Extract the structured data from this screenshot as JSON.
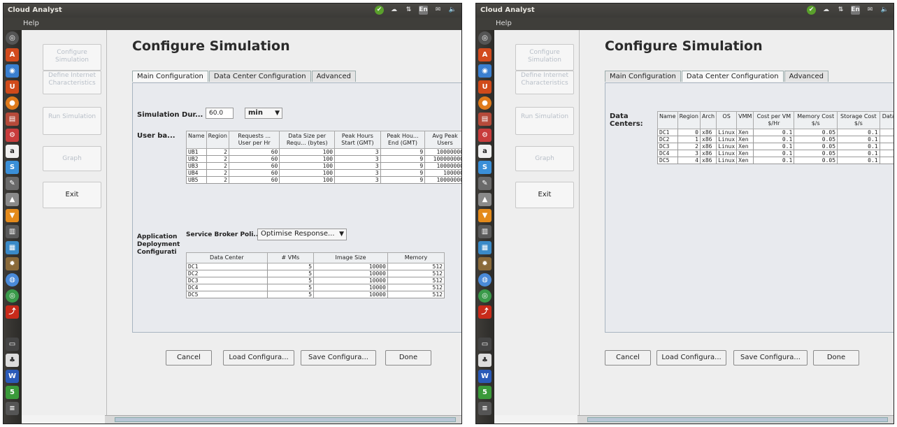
{
  "colors": {
    "accent": "#3a5ea8",
    "titlebar": "#3b3a37",
    "launcher": "#2c2b28",
    "nav_disabled_text": "#b8bfc8"
  },
  "left": {
    "window_title": "Cloud Analyst",
    "menu": "Help",
    "nav": {
      "configure": "Configure Simulation",
      "define": "Define Internet Characteristics",
      "run": "Run Simulation",
      "graph": "Graph",
      "exit": "Exit"
    },
    "page_title": "Configure Simulation",
    "tabs": [
      "Main Configuration",
      "Data Center Configuration",
      "Advanced"
    ],
    "sim_duration_label": "Simulation Dur...",
    "sim_duration_value": "60.0",
    "sim_duration_unit": "min",
    "userbase_label": "User ba...",
    "userbase_headers": [
      "Name",
      "Region",
      "Requests ... User per Hr",
      "Data Size per Requ... (bytes)",
      "Peak Hours Start (GMT)",
      "Peak Hou... End (GMT)",
      "Avg Peak Users"
    ],
    "userbase_rows": [
      [
        "UB1",
        "2",
        "60",
        "100",
        "3",
        "9",
        "10000000"
      ],
      [
        "UB2",
        "2",
        "60",
        "100",
        "3",
        "9",
        "100000000"
      ],
      [
        "UB3",
        "2",
        "60",
        "100",
        "3",
        "9",
        "10000000"
      ],
      [
        "UB4",
        "2",
        "60",
        "100",
        "3",
        "9",
        "100000"
      ],
      [
        "UB5",
        "2",
        "60",
        "100",
        "3",
        "9",
        "10000000"
      ]
    ],
    "appdeploy_label": "Application Deployment Configurati",
    "broker_label": "Service Broker Poli...",
    "broker_value": "Optimise Response...",
    "deploy_headers": [
      "Data Center",
      "# VMs",
      "Image Size",
      "Memory"
    ],
    "deploy_rows": [
      [
        "DC1",
        "5",
        "10000",
        "512"
      ],
      [
        "DC2",
        "5",
        "10000",
        "512"
      ],
      [
        "DC3",
        "5",
        "10000",
        "512"
      ],
      [
        "DC4",
        "5",
        "10000",
        "512"
      ],
      [
        "DC5",
        "5",
        "10000",
        "512"
      ]
    ],
    "buttons": {
      "cancel": "Cancel",
      "load": "Load Configura...",
      "save": "Save Configura...",
      "done": "Done"
    }
  },
  "right": {
    "window_title": "Cloud Analyst",
    "menu": "Help",
    "nav": {
      "configure": "Configure Simulation",
      "define": "Define Internet Characteristics",
      "run": "Run Simulation",
      "graph": "Graph",
      "exit": "Exit"
    },
    "page_title": "Configure Simulation",
    "tabs": [
      "Main Configuration",
      "Data Center Configuration",
      "Advanced"
    ],
    "dc_label": "Data Centers:",
    "dc_headers": [
      "Name",
      "Region",
      "Arch",
      "OS",
      "VMM",
      "Cost per VM $/Hr",
      "Memory Cost $/s",
      "Storage Cost $/s",
      "Data Transfer Cost $/Gb"
    ],
    "dc_rows": [
      [
        "DC1",
        "0",
        "x86",
        "Linux",
        "Xen",
        "0.1",
        "0.05",
        "0.1",
        ""
      ],
      [
        "DC2",
        "1",
        "x86",
        "Linux",
        "Xen",
        "0.1",
        "0.05",
        "0.1",
        ""
      ],
      [
        "DC3",
        "2",
        "x86",
        "Linux",
        "Xen",
        "0.1",
        "0.05",
        "0.1",
        ""
      ],
      [
        "DC4",
        "3",
        "x86",
        "Linux",
        "Xen",
        "0.1",
        "0.05",
        "0.1",
        ""
      ],
      [
        "DC5",
        "4",
        "x86",
        "Linux",
        "Xen",
        "0.1",
        "0.05",
        "0.1",
        ""
      ]
    ],
    "buttons": {
      "cancel": "Cancel",
      "load": "Load Configura...",
      "save": "Save Configura...",
      "done": "Done"
    }
  },
  "tray_labels": {
    "keyboard": "En"
  }
}
